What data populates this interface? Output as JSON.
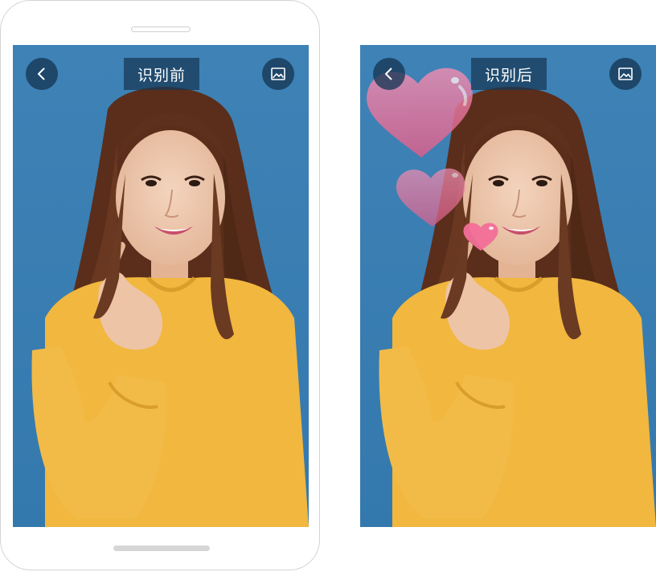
{
  "screens": {
    "before": {
      "title": "识别前",
      "back_icon": "chevron-left-icon",
      "gallery_icon": "image-gallery-icon"
    },
    "after": {
      "title": "识别后",
      "back_icon": "chevron-left-icon",
      "gallery_icon": "image-gallery-icon",
      "effect": "heart-stickers"
    }
  },
  "colors": {
    "background_blue": "#3a7fb3",
    "button_bg": "#163755",
    "sweater": "#f1b73f",
    "heart_pink": "#e56f96"
  }
}
